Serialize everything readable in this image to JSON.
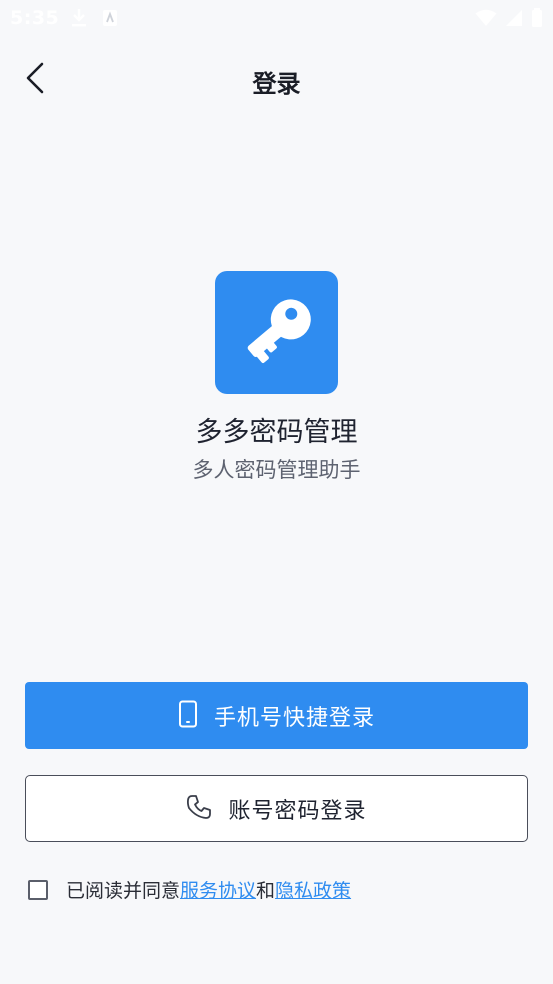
{
  "status_bar": {
    "time": "5:35"
  },
  "header": {
    "title": "登录"
  },
  "app": {
    "name": "多多密码管理",
    "tagline": "多人密码管理助手",
    "logo_icon": "key-icon",
    "brand_color": "#2f8cf0"
  },
  "buttons": {
    "phone_login": "手机号快捷登录",
    "password_login": "账号密码登录"
  },
  "agreement": {
    "prefix": "已阅读并同意",
    "service_link": "服务协议",
    "conjunction": "和",
    "privacy_link": "隐私政策",
    "checked": false
  }
}
